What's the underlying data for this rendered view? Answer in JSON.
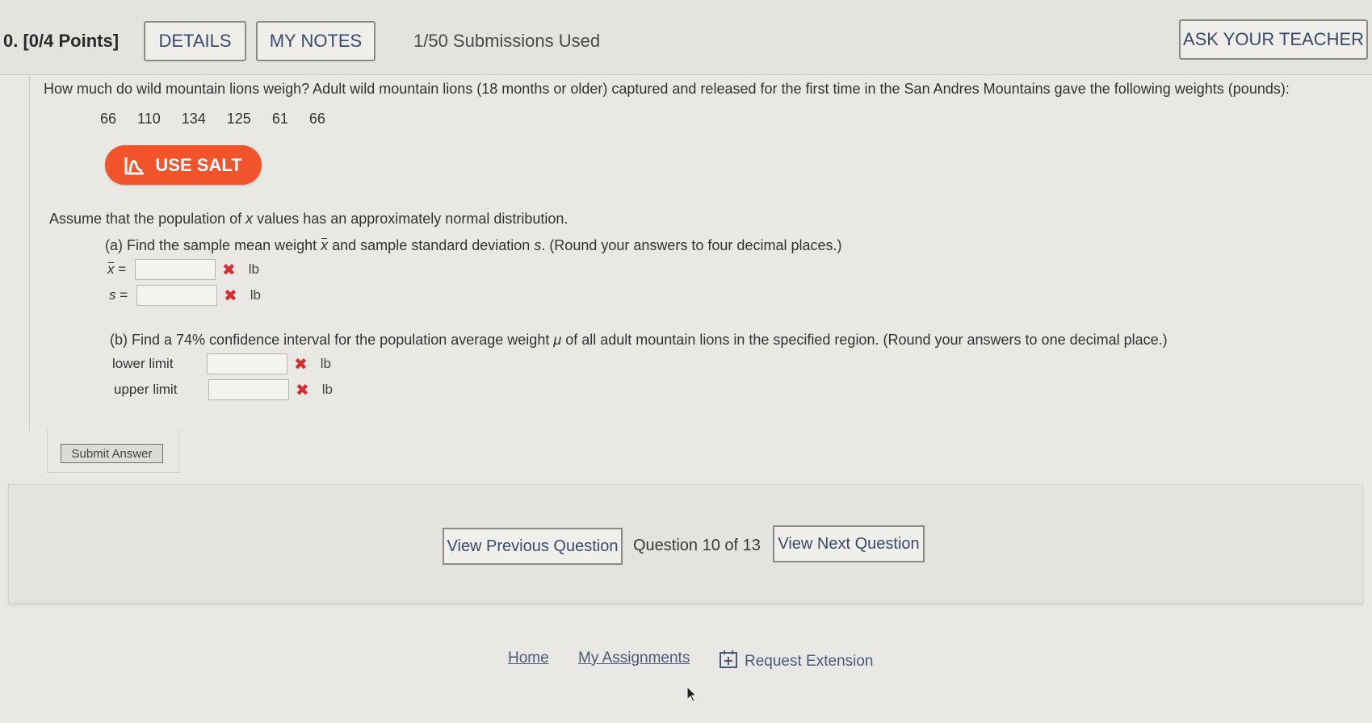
{
  "header": {
    "question_number": "0.",
    "points": "[0/4 Points]",
    "details_label": "DETAILS",
    "my_notes_label": "MY NOTES",
    "submissions": "1/50 Submissions Used",
    "ask_teacher_label": "ASK YOUR TEACHER"
  },
  "question": {
    "prompt": "How much do wild mountain lions weigh? Adult wild mountain lions (18 months or older) captured and released for the first time in the San Andres Mountains gave the following weights (pounds):",
    "data_values": [
      "66",
      "110",
      "134",
      "125",
      "61",
      "66"
    ],
    "salt_label": "USE SALT",
    "assumption_pre": "Assume that the population of ",
    "assumption_var": "x",
    "assumption_post": " values has an approximately normal distribution.",
    "part_a": {
      "text_pre": "(a) Find the sample mean weight ",
      "text_var1": "x",
      "text_mid": " and sample standard deviation ",
      "text_var2": "s",
      "text_post": ". (Round your answers to four decimal places.)",
      "rows": [
        {
          "label": "x",
          "eq": " =",
          "value": "",
          "unit": "lb",
          "status": "✖"
        },
        {
          "label": "s",
          "eq": " =",
          "value": "",
          "unit": "lb",
          "status": "✖"
        }
      ]
    },
    "part_b": {
      "text_pre": "(b) Find a 74% confidence interval for the population average weight ",
      "text_var": "μ",
      "text_post": " of all adult mountain lions in the specified region. (Round your answers to one decimal place.)",
      "rows": [
        {
          "label": "lower limit",
          "value": "",
          "unit": "lb",
          "status": "✖"
        },
        {
          "label": "upper limit",
          "value": "",
          "unit": "lb",
          "status": "✖"
        }
      ]
    },
    "submit_label": "Submit Answer"
  },
  "navigation": {
    "prev_label": "View Previous Question",
    "counter": "Question 10 of 13",
    "next_label": "View Next Question"
  },
  "footer": {
    "home": "Home",
    "assignments": "My Assignments",
    "extension": "Request Extension"
  },
  "colors": {
    "salt_orange": "#f1542a",
    "error_red": "#d92b2b",
    "link_blue": "#4a5a78"
  }
}
